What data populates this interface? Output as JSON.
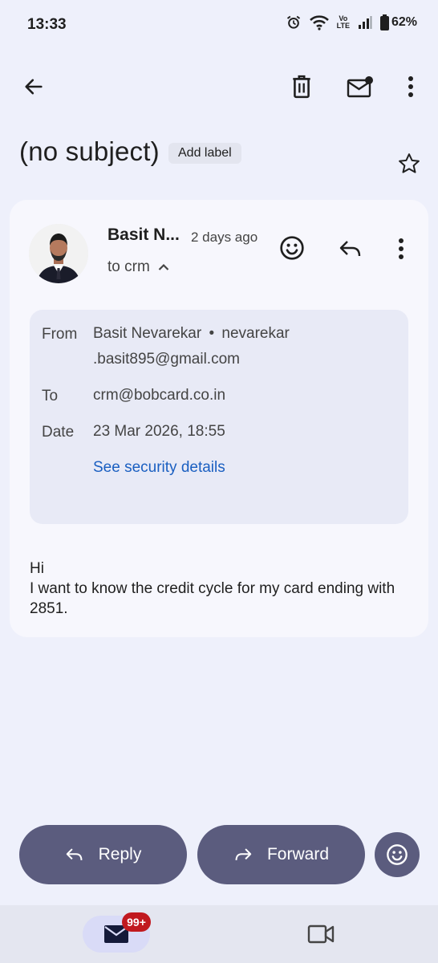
{
  "status_bar": {
    "time": "13:33",
    "volte_top": "Vo",
    "volte_bottom": "LTE",
    "battery": "62%"
  },
  "header": {
    "icons": [
      "back-arrow-icon",
      "delete-icon",
      "mark-unread-icon",
      "more-vert-icon"
    ]
  },
  "email": {
    "subject": "(no subject)",
    "add_label": "Add label",
    "sender_short": "Basit N...",
    "time_ago": "2 days ago",
    "to_line": "to crm",
    "details": {
      "from_label": "From",
      "from_name": "Basit Nevarekar",
      "from_sep": "•",
      "from_email_1": "nevarekar",
      "from_email_2": ".basit895@gmail.com",
      "to_label": "To",
      "to_value": "crm@bobcard.co.in",
      "date_label": "Date",
      "date_value": "23 Mar 2026, 18:55",
      "security_link": "See security details"
    },
    "body_line1": "Hi",
    "body_line2": "I want to know the credit cycle for my card ending with 2851."
  },
  "actions": {
    "reply": "Reply",
    "forward": "Forward"
  },
  "bottom_nav": {
    "mail_badge": "99+"
  },
  "colors": {
    "background": "#EEF0FB",
    "card": "#F7F7FD",
    "details_box": "#E8EAF6",
    "button": "#5B5C7E",
    "link": "#1a5fc1",
    "badge": "#C1191F"
  }
}
